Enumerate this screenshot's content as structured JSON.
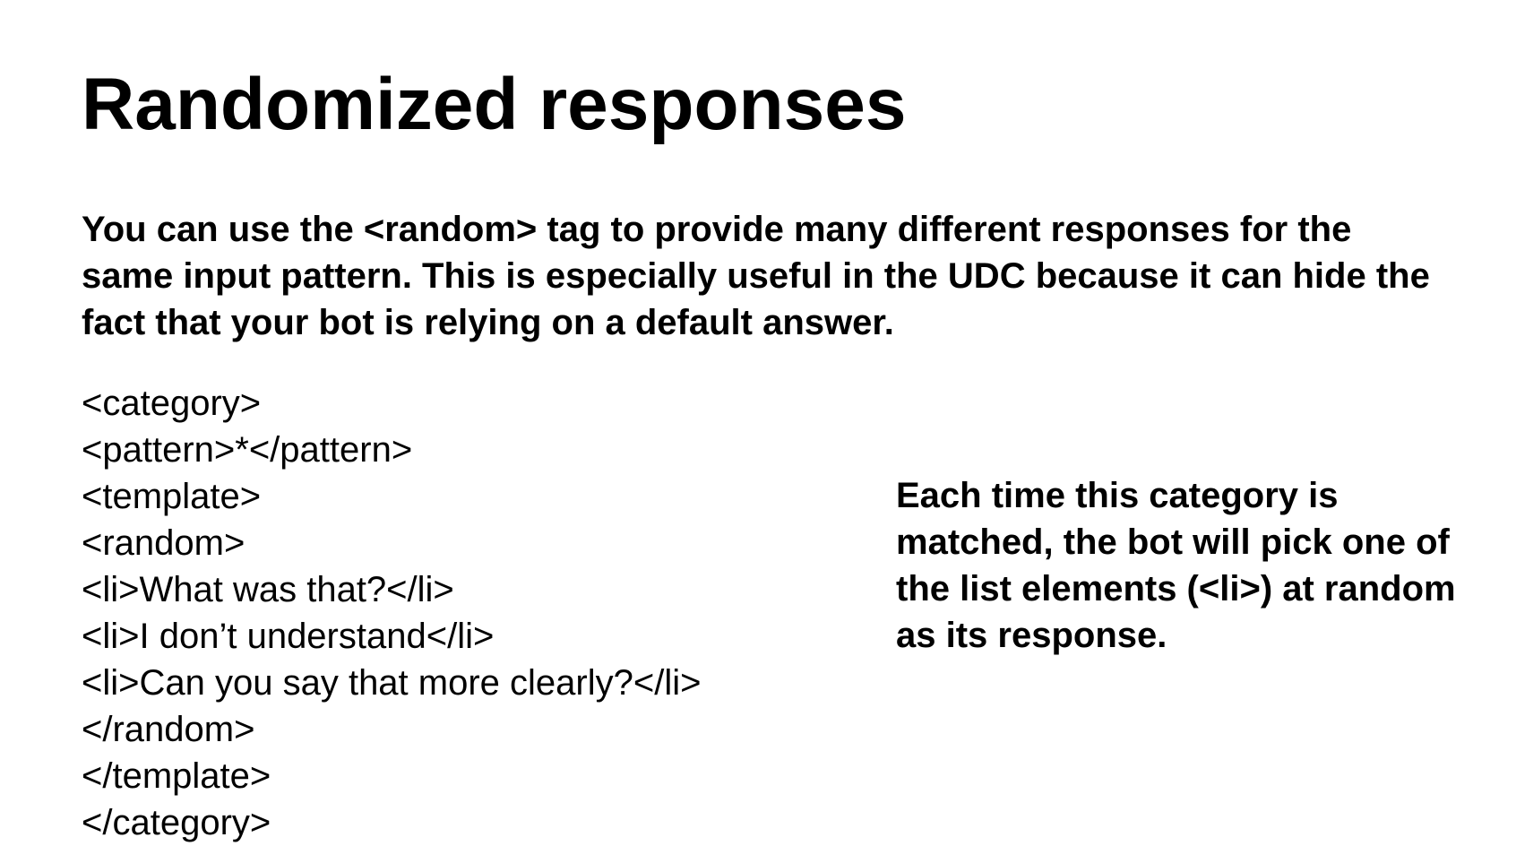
{
  "slide": {
    "title": "Randomized responses",
    "intro": "You can use the <random> tag to provide many different responses for the same input pattern. This is especially useful in the UDC because it can hide the fact that your bot is relying on a default answer.",
    "code_lines": [
      "<category>",
      "<pattern>*</pattern>",
      "<template>",
      "<random>",
      "<li>What was that?</li>",
      "<li>I don’t understand</li>",
      "<li>Can you say that more clearly?</li>",
      "</random>",
      "</template>",
      "</category>"
    ],
    "note": "Each time this category is matched, the bot will pick one of the list elements (<li>) at random as its response."
  }
}
